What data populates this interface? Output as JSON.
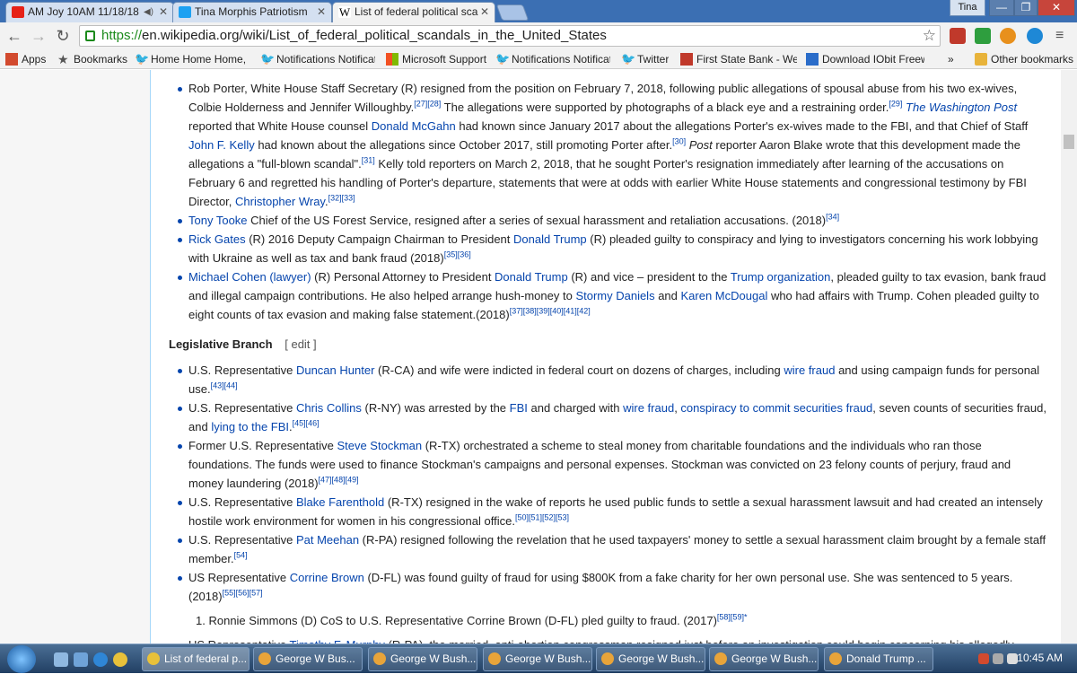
{
  "tabs": [
    {
      "label": "AM Joy 10AM 11/18/18",
      "icon_color": "#e62117",
      "audio": true
    },
    {
      "label": "Tina Morphis Patriotism",
      "icon_color": "#1da1f2"
    },
    {
      "label": "List of federal political sca",
      "icon_color": "#000000",
      "active": true
    }
  ],
  "window": {
    "profile": "Tina",
    "minimize": "—",
    "restore": "❐",
    "close": "✕"
  },
  "toolbar": {
    "back": "←",
    "forward": "→",
    "reload": "↻",
    "url_scheme": "https://",
    "url_rest": "en.wikipedia.org/wiki/List_of_federal_political_scandals_in_the_United_States",
    "star": "☆"
  },
  "bookmarks": [
    {
      "label": "Apps",
      "icon": "apps-icon",
      "color": "#d24a2e"
    },
    {
      "label": "Bookmarks",
      "icon": "star-icon",
      "color": "#555555"
    },
    {
      "label": "Home Home Home, c",
      "icon": "twitter-icon",
      "color": "#1da1f2"
    },
    {
      "label": "Notifications Notificat",
      "icon": "twitter-icon",
      "color": "#1da1f2"
    },
    {
      "label": "Microsoft Support",
      "icon": "microsoft-icon",
      "color": "#f25022"
    },
    {
      "label": "Notifications Notificat",
      "icon": "twitter-icon",
      "color": "#1da1f2"
    },
    {
      "label": "Twitter",
      "icon": "twitter-icon",
      "color": "#1da1f2"
    },
    {
      "label": "First State Bank - Welc",
      "icon": "bank-icon",
      "color": "#c0392b"
    },
    {
      "label": "Download IObit Freew",
      "icon": "download-icon",
      "color": "#2a6cc9"
    },
    {
      "label": "»",
      "icon": "",
      "color": ""
    },
    {
      "label": "Other bookmarks",
      "icon": "folder-icon",
      "color": "#e8b33a"
    }
  ],
  "article": {
    "executive_items": [
      {
        "segments": [
          {
            "t": "Rob Porter, White House Staff Secretary (R) resigned from the position on February 7, 2018, following public allegations of spousal abuse from his two ex-wives, Colbie Holderness and Jennifer Willoughby."
          },
          {
            "t": "[27][28]",
            "sup": true
          },
          {
            "t": " The allegations were supported by photographs of a black eye and a restraining order."
          },
          {
            "t": "[29]",
            "sup": true
          },
          {
            "t": " "
          },
          {
            "t": "The Washington Post",
            "link": true,
            "italic": true
          },
          {
            "t": " reported that White House counsel "
          },
          {
            "t": "Donald McGahn",
            "link": true
          },
          {
            "t": " had known since January 2017 about the allegations Porter's ex-wives made to the FBI, and that Chief of Staff "
          },
          {
            "t": "John F. Kelly",
            "link": true
          },
          {
            "t": " had known about the allegations since October 2017, still promoting Porter after."
          },
          {
            "t": "[30]",
            "sup": true
          },
          {
            "t": " "
          },
          {
            "t": "Post",
            "italic": true
          },
          {
            "t": " reporter Aaron Blake wrote that this development made the allegations a \"full-blown scandal\"."
          },
          {
            "t": "[31]",
            "sup": true
          },
          {
            "t": " Kelly told reporters on March 2, 2018, that he sought Porter's resignation immediately after learning of the accusations on February 6 and regretted his handling of Porter's departure, statements that were at odds with earlier White House statements and congressional testimony by FBI Director, "
          },
          {
            "t": "Christopher Wray",
            "link": true
          },
          {
            "t": "."
          },
          {
            "t": "[32][33]",
            "sup": true
          }
        ]
      },
      {
        "segments": [
          {
            "t": "Tony Tooke",
            "link": true
          },
          {
            "t": " Chief of the US Forest Service, resigned after a series of sexual harassment and retaliation accusations. (2018)"
          },
          {
            "t": "[34]",
            "sup": true
          }
        ]
      },
      {
        "segments": [
          {
            "t": "Rick Gates",
            "link": true
          },
          {
            "t": " (R) 2016 Deputy Campaign Chairman to President "
          },
          {
            "t": "Donald Trump",
            "link": true
          },
          {
            "t": " (R) pleaded guilty to conspiracy and lying to investigators concerning his work lobbying with Ukraine as well as tax and bank fraud (2018)"
          },
          {
            "t": "[35][36]",
            "sup": true
          }
        ]
      },
      {
        "segments": [
          {
            "t": "Michael Cohen (lawyer)",
            "link": true
          },
          {
            "t": " (R) Personal Attorney to President "
          },
          {
            "t": "Donald Trump",
            "link": true
          },
          {
            "t": " (R) and vice – president to the "
          },
          {
            "t": "Trump organization",
            "link": true
          },
          {
            "t": ", pleaded guilty to tax evasion, bank fraud and illegal campaign contributions. He also helped arrange hush-money to "
          },
          {
            "t": "Stormy Daniels",
            "link": true
          },
          {
            "t": " and "
          },
          {
            "t": "Karen McDougal",
            "link": true
          },
          {
            "t": " who had affairs with Trump. Cohen pleaded guilty to eight counts of tax evasion and making false statement.(2018)"
          },
          {
            "t": "[37][38][39][40][41][42]",
            "sup": true
          }
        ]
      }
    ],
    "section_heading": "Legislative Branch",
    "section_edit": "[ edit ]",
    "legislative_items": [
      {
        "segments": [
          {
            "t": "U.S. Representative "
          },
          {
            "t": "Duncan Hunter",
            "link": true
          },
          {
            "t": " (R-CA) and wife were indicted in federal court on dozens of charges, including "
          },
          {
            "t": "wire fraud",
            "link": true
          },
          {
            "t": " and using campaign funds for personal use."
          },
          {
            "t": "[43][44]",
            "sup": true
          }
        ]
      },
      {
        "segments": [
          {
            "t": "U.S. Representative "
          },
          {
            "t": "Chris Collins",
            "link": true
          },
          {
            "t": " (R-NY) was arrested by the "
          },
          {
            "t": "FBI",
            "link": true
          },
          {
            "t": " and charged with "
          },
          {
            "t": "wire fraud",
            "link": true
          },
          {
            "t": ", "
          },
          {
            "t": "conspiracy to commit securities fraud",
            "link": true
          },
          {
            "t": ", seven counts of securities fraud, and "
          },
          {
            "t": "lying to the FBI",
            "link": true
          },
          {
            "t": "."
          },
          {
            "t": "[45][46]",
            "sup": true
          }
        ]
      },
      {
        "segments": [
          {
            "t": "Former U.S. Representative "
          },
          {
            "t": "Steve Stockman",
            "link": true
          },
          {
            "t": " (R-TX) orchestrated a scheme to steal money from charitable foundations and the individuals who ran those foundations. The funds were used to finance Stockman's campaigns and personal expenses. Stockman was convicted on 23 felony counts of perjury, fraud and money laundering (2018)"
          },
          {
            "t": "[47][48][49]",
            "sup": true
          }
        ]
      },
      {
        "segments": [
          {
            "t": "U.S. Representative "
          },
          {
            "t": "Blake Farenthold",
            "link": true
          },
          {
            "t": " (R-TX) resigned in the wake of reports he used public funds to settle a sexual harassment lawsuit and had created an intensely hostile work environment for women in his congressional office."
          },
          {
            "t": "[50][51][52][53]",
            "sup": true
          }
        ]
      },
      {
        "segments": [
          {
            "t": "U.S. Representative "
          },
          {
            "t": "Pat Meehan",
            "link": true
          },
          {
            "t": " (R-PA) resigned following the revelation that he used taxpayers' money to settle a sexual harassment claim brought by a female staff member."
          },
          {
            "t": "[54]",
            "sup": true
          }
        ]
      },
      {
        "segments": [
          {
            "t": "US Representative "
          },
          {
            "t": "Corrine Brown",
            "link": true
          },
          {
            "t": " (D-FL) was found guilty of fraud for using $800K from a fake charity for her own personal use. She was sentenced to 5 years. (2018)"
          },
          {
            "t": "[55][56][57]",
            "sup": true
          }
        ]
      }
    ],
    "sub_item": {
      "number": "1.",
      "segments": [
        {
          "t": "Ronnie Simmons (D) CoS to U.S. Representative Corrine Brown (D-FL) pled guilty to fraud. (2017)"
        },
        {
          "t": "[58][59]*",
          "sup": true
        }
      ]
    },
    "last_item": {
      "segments": [
        {
          "t": "US Representative "
        },
        {
          "t": "Timothy F. Murphy",
          "link": true
        },
        {
          "t": " (R-PA), the married, anti-abortion congressman resigned just before an investigation could begin concerning his allegedly"
        }
      ]
    }
  },
  "taskbar": {
    "tasks": [
      {
        "label": "List of federal p...",
        "active": true
      },
      {
        "label": "George W Bus..."
      },
      {
        "label": "George W Bush..."
      },
      {
        "label": "George W Bush..."
      },
      {
        "label": "George W Bush..."
      },
      {
        "label": "George W Bush..."
      },
      {
        "label": "Donald Trump ..."
      }
    ],
    "clock": "10:45 AM"
  }
}
